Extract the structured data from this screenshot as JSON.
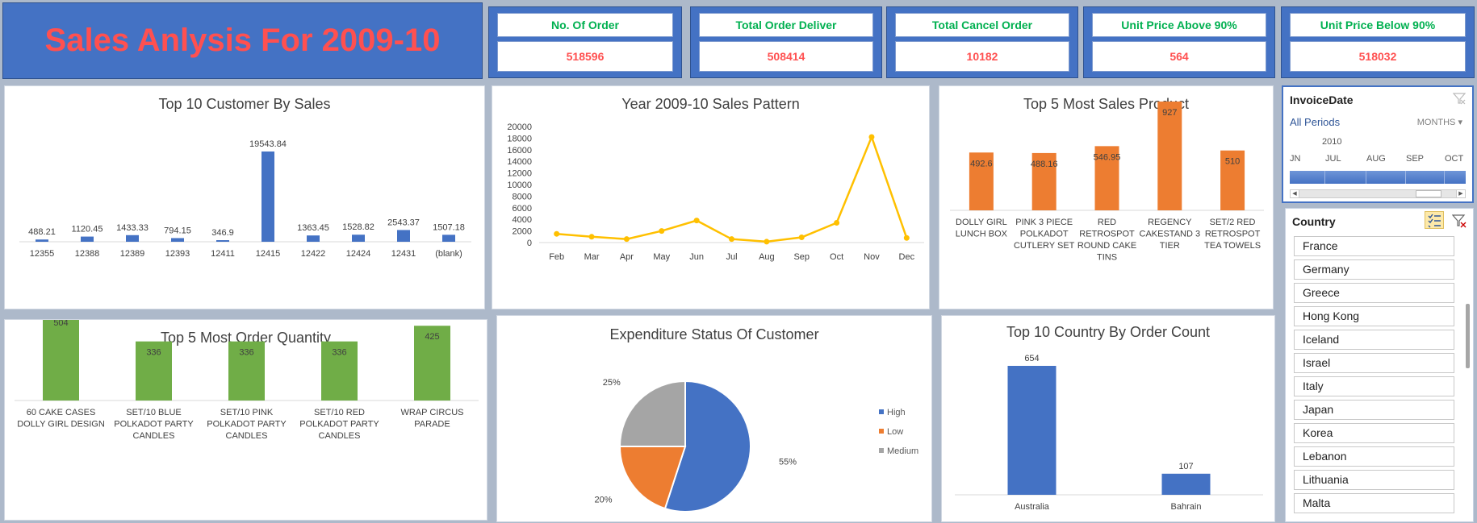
{
  "header": {
    "title": "Sales Anlysis For 2009-10"
  },
  "kpis": [
    {
      "label": "No. Of Order",
      "value": "518596"
    },
    {
      "label": "Total Order Deliver",
      "value": "508414"
    },
    {
      "label": "Total Cancel Order",
      "value": "10182"
    },
    {
      "label": "Unit Price Above 90%",
      "value": "564"
    },
    {
      "label": "Unit Price Below 90%",
      "value": "518032"
    }
  ],
  "colors": {
    "blue": "#4472c4",
    "orange": "#ed7d31",
    "gray": "#a5a5a5",
    "green": "#70ad47",
    "yellow": "#ffc000",
    "kpi_label": "#00b050",
    "kpi_value": "#ff5050"
  },
  "chart_data": [
    {
      "id": "top_customers",
      "type": "bar",
      "title": "Top 10 Customer By Sales",
      "categories": [
        "12355",
        "12388",
        "12389",
        "12393",
        "12411",
        "12415",
        "12422",
        "12424",
        "12431",
        "(blank)"
      ],
      "values": [
        488.21,
        1120.45,
        1433.33,
        794.15,
        346.9,
        19543.84,
        1363.45,
        1528.82,
        2543.37,
        1507.18
      ],
      "data_labels": [
        "488.21",
        "1120.45",
        "1433.33",
        "794.15",
        "346.9",
        "19543.84",
        "1363.45",
        "1528.82",
        "2543.37",
        "1507.18"
      ]
    },
    {
      "id": "sales_pattern",
      "type": "line",
      "title": "Year 2009-10 Sales Pattern",
      "categories": [
        "Feb",
        "Mar",
        "Apr",
        "May",
        "Jun",
        "Jul",
        "Aug",
        "Sep",
        "Oct",
        "Nov",
        "Dec"
      ],
      "values": [
        1500,
        1000,
        600,
        2000,
        3800,
        600,
        150,
        900,
        3400,
        18200,
        800
      ],
      "ylim": [
        0,
        20000
      ],
      "yticks": [
        "0",
        "2000",
        "4000",
        "6000",
        "8000",
        "10000",
        "12000",
        "14000",
        "16000",
        "18000",
        "20000"
      ]
    },
    {
      "id": "top_products",
      "type": "bar",
      "title": "Top 5 Most Sales Product",
      "categories": [
        [
          "DOLLY GIRL",
          "LUNCH BOX"
        ],
        [
          "PINK 3 PIECE",
          "POLKADOT",
          "CUTLERY SET"
        ],
        [
          "RED",
          "RETROSPOT",
          "ROUND CAKE",
          "TINS"
        ],
        [
          "REGENCY",
          "CAKESTAND 3",
          "TIER"
        ],
        [
          "SET/2 RED",
          "RETROSPOT",
          "TEA TOWELS"
        ]
      ],
      "values": [
        492.6,
        488.16,
        546.95,
        927,
        510
      ],
      "data_labels": [
        "492.6",
        "488.16",
        "546.95",
        "927",
        "510"
      ]
    },
    {
      "id": "order_quantity",
      "type": "bar",
      "title": "Top 5 Most Order Quantity",
      "categories": [
        [
          "60 CAKE CASES",
          "DOLLY GIRL DESIGN"
        ],
        [
          "SET/10 BLUE",
          "POLKADOT PARTY",
          "CANDLES"
        ],
        [
          "SET/10 PINK",
          "POLKADOT PARTY",
          "CANDLES"
        ],
        [
          "SET/10 RED",
          "POLKADOT PARTY",
          "CANDLES"
        ],
        [
          "WRAP CIRCUS",
          "PARADE"
        ]
      ],
      "values": [
        504,
        336,
        336,
        336,
        425
      ],
      "data_labels": [
        "504",
        "336",
        "336",
        "336",
        "425"
      ]
    },
    {
      "id": "expenditure",
      "type": "pie",
      "title": "Expenditure Status Of Customer",
      "labels": [
        "High",
        "Low",
        "Medium"
      ],
      "values": [
        55,
        20,
        25
      ],
      "data_labels": [
        "55%",
        "20%",
        "25%"
      ],
      "legend": "right"
    },
    {
      "id": "top_country",
      "type": "bar",
      "title": "Top 10 Country By Order Count",
      "categories": [
        "Australia",
        "Bahrain"
      ],
      "values": [
        654,
        107
      ],
      "data_labels": [
        "654",
        "107"
      ]
    }
  ],
  "timeline": {
    "title": "InvoiceDate",
    "period_label": "All Periods",
    "level": "MONTHS",
    "year": "2010",
    "months": [
      "JN",
      "JUL",
      "AUG",
      "SEP",
      "OCT"
    ]
  },
  "country_slicer": {
    "title": "Country",
    "items": [
      "France",
      "Germany",
      "Greece",
      "Hong Kong",
      "Iceland",
      "Israel",
      "Italy",
      "Japan",
      "Korea",
      "Lebanon",
      "Lithuania",
      "Malta"
    ]
  }
}
